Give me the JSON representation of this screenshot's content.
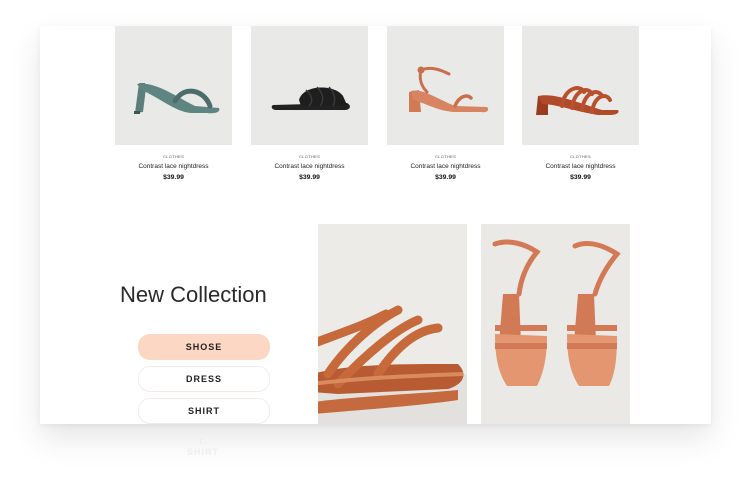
{
  "products": [
    {
      "category": "Clothes",
      "name": "Contrast lace nightdress",
      "price": "$39.99",
      "image_icon": "green-heeled-sandal"
    },
    {
      "category": "Clothes",
      "name": "Contrast lace nightdress",
      "price": "$39.99",
      "image_icon": "black-slide-sandal"
    },
    {
      "category": "Clothes",
      "name": "Contrast lace nightdress",
      "price": "$39.99",
      "image_icon": "orange-strap-heel"
    },
    {
      "category": "Clothes",
      "name": "Contrast lace nightdress",
      "price": "$39.99",
      "image_icon": "rust-strappy-mule"
    }
  ],
  "collection": {
    "title": "New Collection",
    "tabs": [
      "SHOSE",
      "DRESS",
      "SHIRT",
      "T-SHIRT"
    ],
    "active_tab": "SHOSE"
  },
  "colors": {
    "accent": "#fcd8c4",
    "sandal": "#d27955"
  }
}
